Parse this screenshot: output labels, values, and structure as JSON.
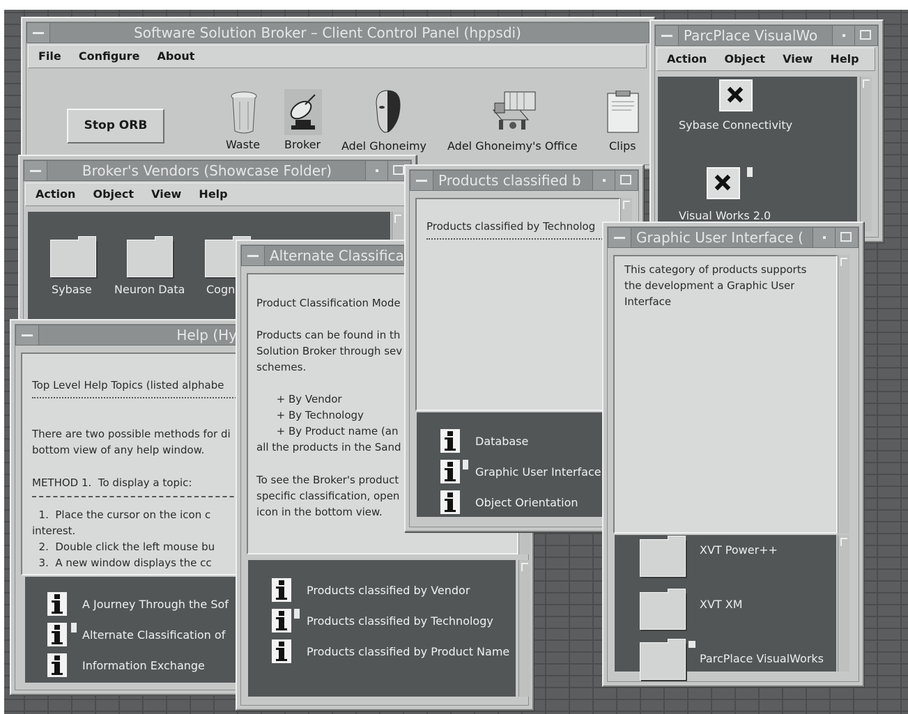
{
  "control_panel": {
    "title": "Software Solution Broker – Client Control Panel (hppsdi)",
    "menu": [
      "File",
      "Configure",
      "About"
    ],
    "stop_button": "Stop ORB",
    "icons": [
      "Waste",
      "Broker",
      "Adel Ghoneimy",
      "Adel Ghoneimy's Office",
      "Clips"
    ]
  },
  "parcplace_window": {
    "title": "ParcPlace VisualWo",
    "menu": [
      "Action",
      "Object",
      "View",
      "Help"
    ],
    "items": [
      "Sybase Connectivity",
      "Visual Works 2.0"
    ]
  },
  "vendors_window": {
    "title": "Broker's Vendors (Showcase Folder)",
    "menu": [
      "Action",
      "Object",
      "View",
      "Help"
    ],
    "folders": [
      "Sybase",
      "Neuron Data",
      "Cogn"
    ]
  },
  "help_window": {
    "title": "Help (Hype",
    "lines": [
      "Top Level Help Topics (listed alphabe",
      "There are two possible methods for di",
      "bottom view of any help window.",
      "METHOD 1.  To display a topic:",
      "  1.  Place the cursor on the icon c",
      "interest.",
      "  2.  Double click the left mouse bu",
      "  3.  A new window displays the cc"
    ],
    "items": [
      "A Journey Through the Sof",
      "Alternate Classification of",
      "Information Exchange"
    ]
  },
  "alternate_window": {
    "title": "Alternate Classifica",
    "lines": [
      "Product Classification Mode",
      "Products can be found in th",
      "Solution Broker through sev",
      "schemes.",
      "      + By Vendor",
      "      + By Technology",
      "      + By Product name (an",
      "all the products in the Sand",
      "To see the Broker's product",
      "specific classification, open",
      "icon in the bottom view."
    ],
    "items": [
      "Products classified by Vendor",
      "Products classified by Technology",
      "Products classified by Product Name"
    ]
  },
  "products_window": {
    "title": "Products classified b",
    "heading": "Products classified by Technolog",
    "items": [
      "Database",
      "Graphic User Interface",
      "Object Orientation"
    ]
  },
  "gui_window": {
    "title": "Graphic User Interface (",
    "lines": [
      "This category of products supports",
      "the development a Graphic User",
      "Interface"
    ],
    "items": [
      "XVT Power++",
      "XVT XM",
      "ParcPlace VisualWorks"
    ]
  }
}
